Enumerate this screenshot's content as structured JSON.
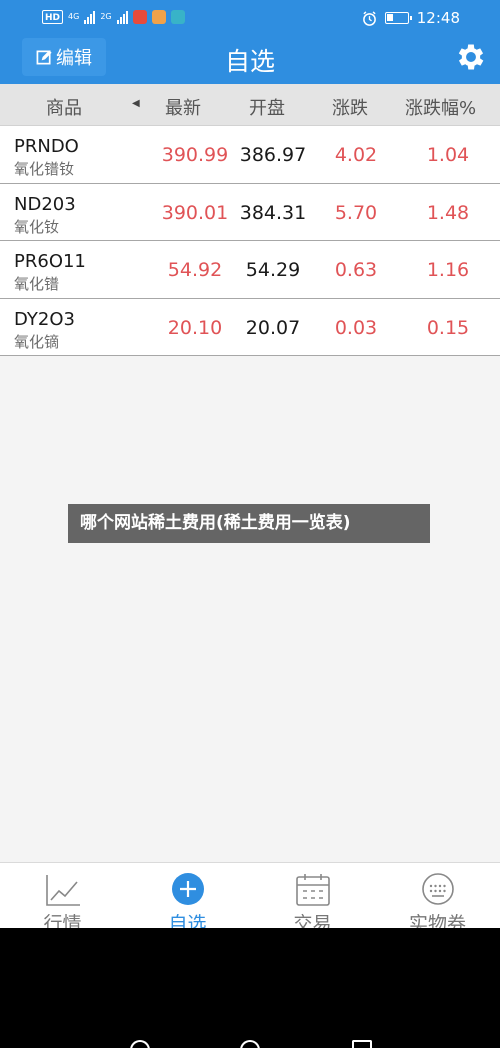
{
  "status_bar": {
    "hd_label": "HD",
    "net1": "4G",
    "net2": "2G",
    "time": "12:48"
  },
  "header": {
    "edit_label": "编辑",
    "title": "自选"
  },
  "columns": {
    "name": "商品",
    "latest": "最新",
    "open": "开盘",
    "change": "涨跌",
    "change_pct": "涨跌幅%"
  },
  "rows": [
    {
      "symbol": "PRNDO",
      "name": "氧化镨钕",
      "latest": "390.99",
      "open": "386.97",
      "change": "4.02",
      "change_pct": "1.04"
    },
    {
      "symbol": "ND203",
      "name": "氧化钕",
      "latest": "390.01",
      "open": "384.31",
      "change": "5.70",
      "change_pct": "1.48"
    },
    {
      "symbol": "PR6O11",
      "name": "氧化镨",
      "latest": "54.92",
      "open": "54.29",
      "change": "0.63",
      "change_pct": "1.16"
    },
    {
      "symbol": "DY2O3",
      "name": "氧化镝",
      "latest": "20.10",
      "open": "20.07",
      "change": "0.03",
      "change_pct": "0.15"
    }
  ],
  "overlay_text": "哪个网站稀土费用(稀土费用一览表)",
  "tabs": [
    {
      "label": "行情",
      "icon": "chart-icon"
    },
    {
      "label": "自选",
      "icon": "plus-circle-icon"
    },
    {
      "label": "交易",
      "icon": "calendar-icon"
    },
    {
      "label": "实物券",
      "icon": "keypad-icon"
    }
  ],
  "colors": {
    "brand_blue": "#2f8ee0",
    "up_red": "#e05356"
  }
}
